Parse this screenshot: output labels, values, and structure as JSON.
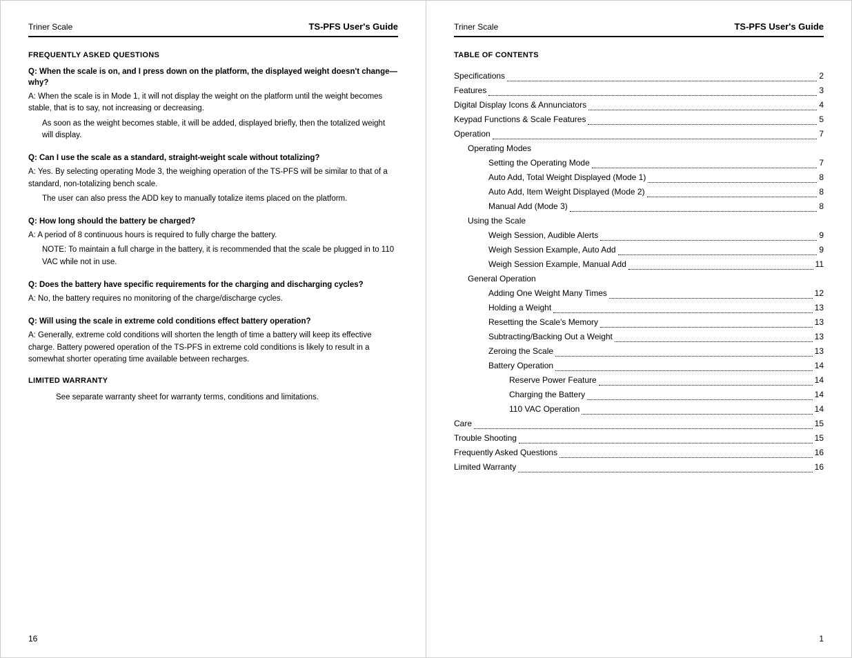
{
  "left_page": {
    "brand": "Triner Scale",
    "title": "TS-PFS User's Guide",
    "page_number": "16",
    "sections": [
      {
        "heading": "FREQUENTLY ASKED QUESTIONS",
        "faqs": [
          {
            "question": "Q: When the scale is on, and I press down on the platform, the displayed weight doesn't change—why?",
            "answer_parts": [
              "A: When the scale is in Mode 1, it will not display the weight on the platform until the weight becomes stable, that is to say, not increasing or decreasing.",
              "As soon as the weight becomes stable, it will be added, displayed briefly, then the totalized weight will display."
            ]
          },
          {
            "question": "Q: Can I use the scale as a standard, straight-weight scale without totalizing?",
            "answer_parts": [
              "A: Yes. By selecting operating Mode 3, the weighing operation of the TS-PFS will be similar to that of a standard, non-totalizing bench scale.",
              "The user can also press the ADD key to manually totalize items placed on the platform."
            ]
          },
          {
            "question": "Q: How long should the battery be charged?",
            "answer_parts": [
              "A: A period of 8 continuous hours is required to fully charge the battery.",
              "NOTE: To maintain a full charge in the battery, it is recommended that the scale be plugged in to 110 VAC while not in use."
            ]
          },
          {
            "question": "Q: Does the battery have specific requirements for the charging and discharging cycles?",
            "answer_parts": [
              "A: No, the battery requires no monitoring of the charge/discharge cycles."
            ]
          },
          {
            "question": "Q: Will using the scale in extreme cold conditions effect battery operation?",
            "answer_parts": [
              "A: Generally, extreme cold conditions will shorten the length of time a battery will keep its effective charge. Battery powered operation of the TS-PFS in extreme cold conditions is likely to result in a somewhat shorter operating time available between recharges."
            ]
          }
        ]
      },
      {
        "heading": "LIMITED WARRANTY",
        "text": "See separate warranty sheet for warranty terms, conditions and limitations."
      }
    ]
  },
  "right_page": {
    "brand": "Triner Scale",
    "title": "TS-PFS User's Guide",
    "page_number": "1",
    "toc_heading": "TABLE OF CONTENTS",
    "toc_items": [
      {
        "label": "Specifications",
        "dots": true,
        "page": "2",
        "indent": 0
      },
      {
        "label": "Features",
        "dots": true,
        "page": "3",
        "indent": 0
      },
      {
        "label": "Digital Display Icons & Annunciators",
        "dots": true,
        "page": "4",
        "indent": 0
      },
      {
        "label": "Keypad Functions & Scale Features",
        "dots": true,
        "page": "5",
        "indent": 0
      },
      {
        "label": "Operation",
        "dots": true,
        "page": "7",
        "indent": 0
      },
      {
        "label": "Operating Modes",
        "dots": false,
        "page": "",
        "indent": 1
      },
      {
        "label": "Setting the Operating Mode",
        "dots": true,
        "page": "7",
        "indent": 2
      },
      {
        "label": "Auto Add, Total Weight Displayed (Mode 1)",
        "dots": true,
        "page": "8",
        "indent": 2
      },
      {
        "label": "Auto Add, Item Weight Displayed (Mode 2)",
        "dots": true,
        "page": "8",
        "indent": 2
      },
      {
        "label": "Manual Add (Mode 3)",
        "dots": true,
        "page": "8",
        "indent": 2
      },
      {
        "label": "Using the Scale",
        "dots": false,
        "page": "",
        "indent": 1
      },
      {
        "label": "Weigh Session, Audible Alerts",
        "dots": true,
        "page": "9",
        "indent": 2
      },
      {
        "label": "Weigh Session Example, Auto Add",
        "dots": true,
        "page": "9",
        "indent": 2
      },
      {
        "label": "Weigh Session Example, Manual Add",
        "dots": true,
        "page": "11",
        "indent": 2
      },
      {
        "label": "General Operation",
        "dots": false,
        "page": "",
        "indent": 1
      },
      {
        "label": "Adding One Weight Many Times",
        "dots": true,
        "page": "12",
        "indent": 2
      },
      {
        "label": "Holding a Weight",
        "dots": true,
        "page": "13",
        "indent": 2
      },
      {
        "label": "Resetting the Scale's Memory",
        "dots": true,
        "page": "13",
        "indent": 2
      },
      {
        "label": "Subtracting/Backing Out a Weight",
        "dots": true,
        "page": "13",
        "indent": 2
      },
      {
        "label": "Zeroing the Scale",
        "dots": true,
        "page": "13",
        "indent": 2
      },
      {
        "label": "Battery Operation",
        "dots": true,
        "page": "14",
        "indent": 2
      },
      {
        "label": "Reserve Power Feature",
        "dots": true,
        "page": "14",
        "indent": 3
      },
      {
        "label": "Charging the Battery",
        "dots": true,
        "page": "14",
        "indent": 3
      },
      {
        "label": "110 VAC Operation",
        "dots": true,
        "page": "14",
        "indent": 3
      },
      {
        "label": "Care",
        "dots": true,
        "page": "15",
        "indent": 0
      },
      {
        "label": "Trouble Shooting",
        "dots": true,
        "page": "15",
        "indent": 0
      },
      {
        "label": "Frequently Asked Questions",
        "dots": true,
        "page": "16",
        "indent": 0
      },
      {
        "label": "Limited Warranty",
        "dots": true,
        "page": "16",
        "indent": 0
      }
    ]
  }
}
